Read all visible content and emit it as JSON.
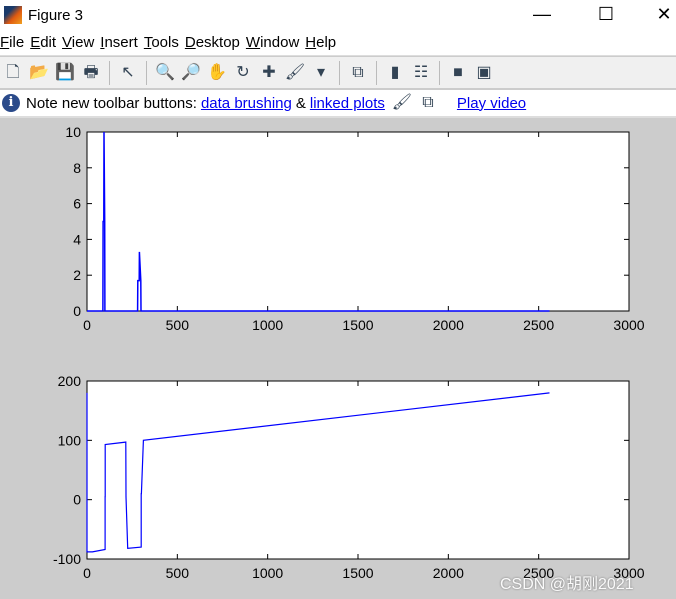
{
  "window": {
    "title": "Figure 3",
    "minimize": "—",
    "maximize": "☐",
    "close": "✕"
  },
  "menu": [
    "File",
    "Edit",
    "View",
    "Insert",
    "Tools",
    "Desktop",
    "Window",
    "Help"
  ],
  "toolbar": [
    [
      "new-file",
      "🗋"
    ],
    [
      "open-folder",
      "📂"
    ],
    [
      "save",
      "💾"
    ],
    [
      "print",
      "🖶"
    ],
    "|",
    [
      "edit-pointer",
      "↖"
    ],
    "|",
    [
      "zoom-in",
      "🔍"
    ],
    [
      "zoom-out",
      "🔎"
    ],
    [
      "pan-hand",
      "✋"
    ],
    [
      "rotate-3d",
      "↻"
    ],
    [
      "data-cursor",
      "✚"
    ],
    [
      "brush",
      "🖌"
    ],
    [
      "dropdown-arrow",
      "▾"
    ],
    "|",
    [
      "link-plots",
      "⧉"
    ],
    "|",
    [
      "colorbar",
      "▮"
    ],
    [
      "legend",
      "☷"
    ],
    "|",
    [
      "hide-plot-tools",
      "■"
    ],
    [
      "show-plot-tools",
      "▣"
    ]
  ],
  "note": {
    "text": "Note new toolbar buttons:",
    "link1": "data brushing",
    "amp": "&",
    "link2": "linked plots",
    "video": "Play video"
  },
  "watermark": "CSDN @胡刚2021",
  "chart_data": [
    {
      "type": "line",
      "color": "#0000ff",
      "xlim": [
        0,
        3000
      ],
      "ylim": [
        0,
        10
      ],
      "xticks": [
        0,
        500,
        1000,
        1500,
        2000,
        2500,
        3000
      ],
      "yticks": [
        0,
        2,
        4,
        6,
        8,
        10
      ],
      "x": [
        0,
        88,
        89,
        93,
        94,
        98,
        99,
        280,
        281,
        289,
        290,
        298,
        299,
        2560
      ],
      "y": [
        0,
        0,
        5,
        5,
        10,
        5,
        0,
        0,
        1.7,
        1.7,
        3.3,
        1.7,
        0,
        0
      ]
    },
    {
      "type": "line",
      "color": "#0000ff",
      "xlim": [
        0,
        3000
      ],
      "ylim": [
        -100,
        200
      ],
      "xticks": [
        0,
        500,
        1000,
        1500,
        2000,
        2500,
        3000
      ],
      "yticks": [
        -100,
        0,
        100,
        200
      ],
      "x": [
        0,
        0,
        30,
        100,
        100,
        101,
        101,
        215,
        215,
        216,
        225,
        225,
        300,
        300,
        301,
        312,
        312,
        2560
      ],
      "y": [
        180,
        -88,
        -88,
        -84,
        5,
        5,
        93,
        97,
        97,
        5,
        -82,
        -82,
        -80,
        10,
        10,
        100,
        100,
        180
      ]
    }
  ]
}
